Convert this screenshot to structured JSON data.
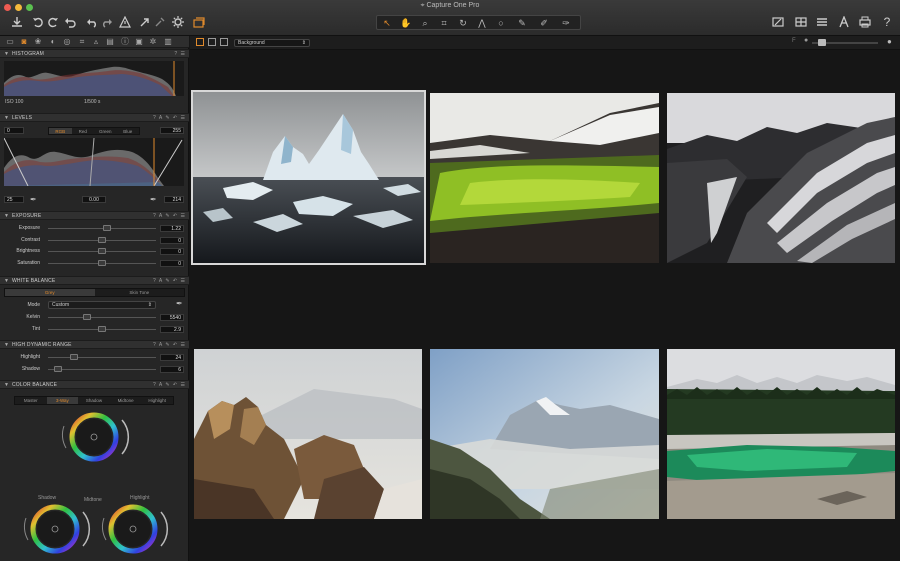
{
  "window": {
    "title": "Capture One Pro",
    "traffic_colors": [
      "#ee5b52",
      "#f3b93c",
      "#5bc150"
    ]
  },
  "toolbar": {
    "left_icons": [
      "import-icon",
      "rotate-left-icon",
      "rotate-right-icon",
      "undo-icon",
      "undo-step-icon",
      "redo-icon",
      "warning-icon",
      "export-icon",
      "process-icon",
      "settings-icon",
      "sessions-icon"
    ],
    "cursor_tools": [
      "select-cursor-icon",
      "pan-icon",
      "loupe-icon",
      "crop-icon",
      "rotate-tool-icon",
      "keystone-icon",
      "spot-icon",
      "picker-icon",
      "brush-icon",
      "eraser-icon"
    ],
    "right_icons": [
      "edit-icon",
      "grid-icon",
      "list-icon",
      "text-icon",
      "print-icon",
      "help-icon"
    ],
    "help_label": "?"
  },
  "tool_tabs": [
    "library",
    "capture",
    "color",
    "exposure",
    "lens",
    "crop",
    "details",
    "local",
    "metadata",
    "output",
    "settings",
    "batch"
  ],
  "histogram": {
    "title": "HISTOGRAM",
    "iso": "ISO 100",
    "shutter": "1/500 s"
  },
  "levels": {
    "title": "LEVELS",
    "left_value": "0",
    "right_value": "255",
    "channels": [
      "RGB",
      "Red",
      "Green",
      "Blue"
    ],
    "active_channel": "RGB",
    "low_value": "25",
    "mid_value": "0.00",
    "high_value": "214"
  },
  "exposure": {
    "title": "EXPOSURE",
    "rows": [
      {
        "label": "Exposure",
        "value": "1.22",
        "pos": 0.55
      },
      {
        "label": "Contrast",
        "value": "0",
        "pos": 0.5
      },
      {
        "label": "Brightness",
        "value": "0",
        "pos": 0.5
      },
      {
        "label": "Saturation",
        "value": "0",
        "pos": 0.5
      }
    ]
  },
  "white_balance": {
    "title": "WHITE BALANCE",
    "tabs": [
      "Grey",
      "Skin Tone"
    ],
    "mode_label": "Mode",
    "mode_value": "Custom",
    "rows": [
      {
        "label": "Kelvin",
        "value": "5540",
        "pos": 0.35
      },
      {
        "label": "Tint",
        "value": "2.9",
        "pos": 0.5
      }
    ]
  },
  "hdr": {
    "title": "HIGH DYNAMIC RANGE",
    "rows": [
      {
        "label": "Highlight",
        "value": "24",
        "pos": 0.22
      },
      {
        "label": "Shadow",
        "value": "6",
        "pos": 0.06
      }
    ]
  },
  "color_balance": {
    "title": "COLOR BALANCE",
    "tabs": [
      "Master",
      "3-Way",
      "Shadow",
      "Midtone",
      "Highlight"
    ],
    "active_tab": "3-Way",
    "wheel_labels": [
      "Shadow",
      "Midtone",
      "Highlight"
    ]
  },
  "viewer": {
    "collection": "Background",
    "images": [
      {
        "name": "iceberg",
        "selected": true
      },
      {
        "name": "green-volcanic-field",
        "selected": false
      },
      {
        "name": "striped-mountain-ridge",
        "selected": false
      },
      {
        "name": "rocky-crag",
        "selected": false
      },
      {
        "name": "misty-alps",
        "selected": false
      },
      {
        "name": "green-lake",
        "selected": false
      }
    ]
  },
  "colors": {
    "accent": "#e08a2c",
    "panel": "#262626",
    "viewer": "#161616"
  }
}
